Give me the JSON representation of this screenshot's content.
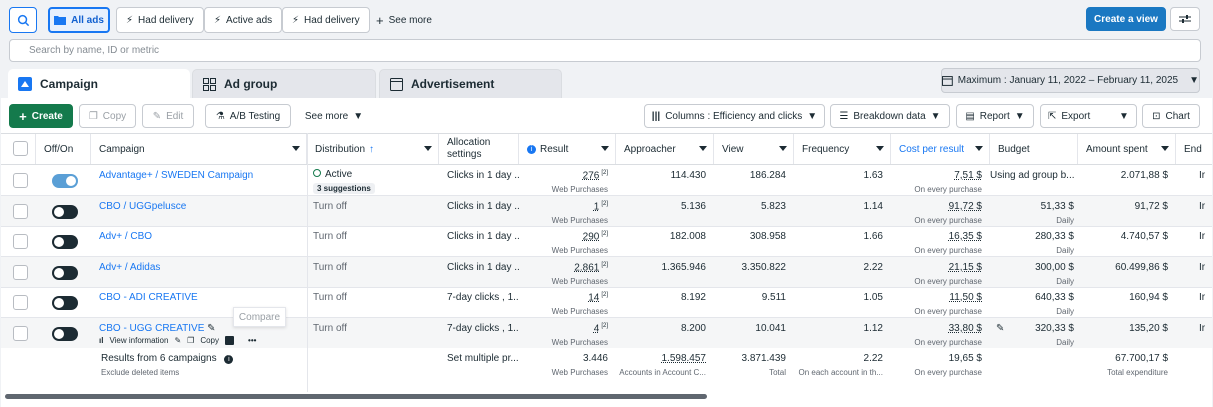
{
  "filters": {
    "all_ads": "All ads",
    "pill1": "Had delivery",
    "pill2": "Active ads",
    "pill3": "Had delivery",
    "see_more": "See more"
  },
  "header": {
    "create_view": "Create a view"
  },
  "search": {
    "placeholder": "Search by name, ID or metric"
  },
  "tabs": [
    {
      "label": "Campaign"
    },
    {
      "label": "Ad group"
    },
    {
      "label": "Advertisement"
    }
  ],
  "date_range": "Maximum : January 11, 2022 – February 11, 2025",
  "toolbar": {
    "create": "Create",
    "copy": "Copy",
    "edit": "Edit",
    "ab_testing": "A/B Testing",
    "see_more": "See more",
    "columns": "Columns : Efficiency and clicks",
    "breakdown": "Breakdown data",
    "report": "Report",
    "export": "Export",
    "chart": "Chart"
  },
  "columns": {
    "off_on": "Off/On",
    "campaign": "Campaign",
    "distribution": "Distribution",
    "allocation": "Allocation settings",
    "result": "Result",
    "approacher": "Approacher",
    "view": "View",
    "frequency": "Frequency",
    "cost_per_result": "Cost per result",
    "budget": "Budget",
    "amount_spent": "Amount spent",
    "end": "End"
  },
  "rows": [
    {
      "name": "Advantage+ / SWEDEN Campaign",
      "status": "Active",
      "suggestions": "3 suggestions",
      "allocation": "Clicks in 1 day ...",
      "result": "276",
      "result_sub": "Web Purchases",
      "approacher": "114.430",
      "view": "186.284",
      "frequency": "1.63",
      "cpr": "7,51 $",
      "cpr_sub": "On every purchase",
      "budget": "Using ad group b...",
      "budget_sub": "",
      "spent": "2.071,88 $",
      "end": "Ir"
    },
    {
      "name": "CBO / UGGpelusce",
      "status": "Turn off",
      "suggestions": "",
      "allocation": "Clicks in 1 day ...",
      "result": "1",
      "result_sub": "Web Purchases",
      "approacher": "5.136",
      "view": "5.823",
      "frequency": "1.14",
      "cpr": "91,72 $",
      "cpr_sub": "On every purchase",
      "budget": "51,33 $",
      "budget_sub": "Daily",
      "spent": "91,72 $",
      "end": "Ir"
    },
    {
      "name": "Adv+ / CBO",
      "status": "Turn off",
      "suggestions": "",
      "allocation": "Clicks in 1 day ...",
      "result": "290",
      "result_sub": "Web Purchases",
      "approacher": "182.008",
      "view": "308.958",
      "frequency": "1.66",
      "cpr": "16,35 $",
      "cpr_sub": "On every purchase",
      "budget": "280,33 $",
      "budget_sub": "Daily",
      "spent": "4.740,57 $",
      "end": "Ir"
    },
    {
      "name": "Adv+ / Adidas",
      "status": "Turn off",
      "suggestions": "",
      "allocation": "Clicks in 1 day ...",
      "result": "2.861",
      "result_sub": "Web Purchases",
      "approacher": "1.365.946",
      "view": "3.350.822",
      "frequency": "2.22",
      "cpr": "21,15 $",
      "cpr_sub": "On every purchase",
      "budget": "300,00 $",
      "budget_sub": "Daily",
      "spent": "60.499,86 $",
      "end": "Ir"
    },
    {
      "name": "CBO - ADI CREATIVE",
      "status": "Turn off",
      "suggestions": "",
      "allocation": "7-day clicks , 1...",
      "result": "14",
      "result_sub": "Web Purchases",
      "approacher": "8.192",
      "view": "9.511",
      "frequency": "1.05",
      "cpr": "11,50 $",
      "cpr_sub": "On every purchase",
      "budget": "640,33 $",
      "budget_sub": "Daily",
      "spent": "160,94 $",
      "end": "Ir"
    },
    {
      "name": "CBO - UGG CREATIVE",
      "status": "Turn off",
      "suggestions": "",
      "allocation": "7-day clicks , 1...",
      "result": "4",
      "result_sub": "Web Purchases",
      "approacher": "8.200",
      "view": "10.041",
      "frequency": "1.12",
      "cpr": "33,80 $",
      "cpr_sub": "On every purchase",
      "budget": "320,33 $",
      "budget_sub": "Daily",
      "spent": "135,20 $",
      "end": "Ir"
    }
  ],
  "row_actions": {
    "view_info": "View information",
    "copy": "Copy",
    "tooltip": "Compare"
  },
  "totals": {
    "label": "Results from 6 campaigns",
    "sub": "Exclude deleted items",
    "allocation": "Set multiple pr...",
    "result": "3.446",
    "result_sub": "Web Purchases",
    "approacher": "1.598.457",
    "approacher_sub": "Accounts in Account C...",
    "view": "3.871.439",
    "view_sub": "Total",
    "frequency": "2.22",
    "frequency_sub": "On each account in th...",
    "cpr": "19,65 $",
    "cpr_sub": "On every purchase",
    "spent": "67.700,17 $",
    "spent_sub": "Total expenditure"
  },
  "colors": {
    "accent": "#1877f2",
    "create_green": "#147a4c",
    "primary_blue": "#1a78c2"
  }
}
